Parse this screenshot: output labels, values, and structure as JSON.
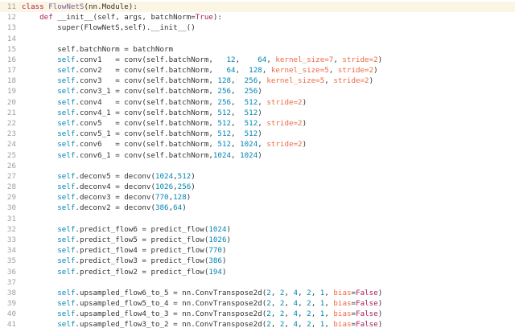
{
  "editor": {
    "lines": [
      {
        "n": "11",
        "hl": true,
        "tokens": [
          [
            "keyword",
            "class "
          ],
          [
            "classname",
            "FlowNetS"
          ],
          [
            "plain",
            "(nn.Module):"
          ]
        ]
      },
      {
        "n": "12",
        "tokens": [
          [
            "plain",
            "    "
          ],
          [
            "keyword",
            "def "
          ],
          [
            "plain",
            "__init__(self, args, batchNorm="
          ],
          [
            "keyword",
            "True"
          ],
          [
            "plain",
            "):"
          ]
        ]
      },
      {
        "n": "13",
        "tokens": [
          [
            "plain",
            "        super(FlowNetS,self).__init__()"
          ]
        ]
      },
      {
        "n": "14",
        "tokens": []
      },
      {
        "n": "15",
        "tokens": [
          [
            "plain",
            "        self.batchNorm = batchNorm"
          ]
        ]
      },
      {
        "n": "16",
        "tokens": [
          [
            "plain",
            "        "
          ],
          [
            "self",
            "self"
          ],
          [
            "plain",
            ".conv1   = conv(self.batchNorm,   "
          ],
          [
            "number",
            "12"
          ],
          [
            "plain",
            ",    "
          ],
          [
            "number",
            "64"
          ],
          [
            "plain",
            ", "
          ],
          [
            "kwarg",
            "kernel_size=7"
          ],
          [
            "plain",
            ", "
          ],
          [
            "kwarg",
            "stride=2"
          ],
          [
            "plain",
            ")"
          ]
        ]
      },
      {
        "n": "17",
        "tokens": [
          [
            "plain",
            "        "
          ],
          [
            "self",
            "self"
          ],
          [
            "plain",
            ".conv2   = conv(self.batchNorm,   "
          ],
          [
            "number",
            "64"
          ],
          [
            "plain",
            ",  "
          ],
          [
            "number",
            "128"
          ],
          [
            "plain",
            ", "
          ],
          [
            "kwarg",
            "kernel_size=5"
          ],
          [
            "plain",
            ", "
          ],
          [
            "kwarg",
            "stride=2"
          ],
          [
            "plain",
            ")"
          ]
        ]
      },
      {
        "n": "18",
        "tokens": [
          [
            "plain",
            "        "
          ],
          [
            "self",
            "self"
          ],
          [
            "plain",
            ".conv3   = conv(self.batchNorm, "
          ],
          [
            "number",
            "128"
          ],
          [
            "plain",
            ",  "
          ],
          [
            "number",
            "256"
          ],
          [
            "plain",
            ", "
          ],
          [
            "kwarg",
            "kernel_size=5"
          ],
          [
            "plain",
            ", "
          ],
          [
            "kwarg",
            "stride=2"
          ],
          [
            "plain",
            ")"
          ]
        ]
      },
      {
        "n": "19",
        "tokens": [
          [
            "plain",
            "        "
          ],
          [
            "self",
            "self"
          ],
          [
            "plain",
            ".conv3_1 = conv(self.batchNorm, "
          ],
          [
            "number",
            "256"
          ],
          [
            "plain",
            ",  "
          ],
          [
            "number",
            "256"
          ],
          [
            "plain",
            ")"
          ]
        ]
      },
      {
        "n": "20",
        "tokens": [
          [
            "plain",
            "        "
          ],
          [
            "self",
            "self"
          ],
          [
            "plain",
            ".conv4   = conv(self.batchNorm, "
          ],
          [
            "number",
            "256"
          ],
          [
            "plain",
            ",  "
          ],
          [
            "number",
            "512"
          ],
          [
            "plain",
            ", "
          ],
          [
            "kwarg",
            "stride=2"
          ],
          [
            "plain",
            ")"
          ]
        ]
      },
      {
        "n": "21",
        "tokens": [
          [
            "plain",
            "        "
          ],
          [
            "self",
            "self"
          ],
          [
            "plain",
            ".conv4_1 = conv(self.batchNorm, "
          ],
          [
            "number",
            "512"
          ],
          [
            "plain",
            ",  "
          ],
          [
            "number",
            "512"
          ],
          [
            "plain",
            ")"
          ]
        ]
      },
      {
        "n": "22",
        "tokens": [
          [
            "plain",
            "        "
          ],
          [
            "self",
            "self"
          ],
          [
            "plain",
            ".conv5   = conv(self.batchNorm, "
          ],
          [
            "number",
            "512"
          ],
          [
            "plain",
            ",  "
          ],
          [
            "number",
            "512"
          ],
          [
            "plain",
            ", "
          ],
          [
            "kwarg",
            "stride=2"
          ],
          [
            "plain",
            ")"
          ]
        ]
      },
      {
        "n": "23",
        "tokens": [
          [
            "plain",
            "        "
          ],
          [
            "self",
            "self"
          ],
          [
            "plain",
            ".conv5_1 = conv(self.batchNorm, "
          ],
          [
            "number",
            "512"
          ],
          [
            "plain",
            ",  "
          ],
          [
            "number",
            "512"
          ],
          [
            "plain",
            ")"
          ]
        ]
      },
      {
        "n": "24",
        "tokens": [
          [
            "plain",
            "        "
          ],
          [
            "self",
            "self"
          ],
          [
            "plain",
            ".conv6   = conv(self.batchNorm, "
          ],
          [
            "number",
            "512"
          ],
          [
            "plain",
            ", "
          ],
          [
            "number",
            "1024"
          ],
          [
            "plain",
            ", "
          ],
          [
            "kwarg",
            "stride=2"
          ],
          [
            "plain",
            ")"
          ]
        ]
      },
      {
        "n": "25",
        "tokens": [
          [
            "plain",
            "        "
          ],
          [
            "self",
            "self"
          ],
          [
            "plain",
            ".conv6_1 = conv(self.batchNorm,"
          ],
          [
            "number",
            "1024"
          ],
          [
            "plain",
            ", "
          ],
          [
            "number",
            "1024"
          ],
          [
            "plain",
            ")"
          ]
        ]
      },
      {
        "n": "26",
        "tokens": []
      },
      {
        "n": "27",
        "tokens": [
          [
            "plain",
            "        "
          ],
          [
            "self",
            "self"
          ],
          [
            "plain",
            ".deconv5 = deconv("
          ],
          [
            "number",
            "1024"
          ],
          [
            "plain",
            ","
          ],
          [
            "number",
            "512"
          ],
          [
            "plain",
            ")"
          ]
        ]
      },
      {
        "n": "28",
        "tokens": [
          [
            "plain",
            "        "
          ],
          [
            "self",
            "self"
          ],
          [
            "plain",
            ".deconv4 = deconv("
          ],
          [
            "number",
            "1026"
          ],
          [
            "plain",
            ","
          ],
          [
            "number",
            "256"
          ],
          [
            "plain",
            ")"
          ]
        ]
      },
      {
        "n": "29",
        "tokens": [
          [
            "plain",
            "        "
          ],
          [
            "self",
            "self"
          ],
          [
            "plain",
            ".deconv3 = deconv("
          ],
          [
            "number",
            "770"
          ],
          [
            "plain",
            ","
          ],
          [
            "number",
            "128"
          ],
          [
            "plain",
            ")"
          ]
        ]
      },
      {
        "n": "30",
        "tokens": [
          [
            "plain",
            "        "
          ],
          [
            "self",
            "self"
          ],
          [
            "plain",
            ".deconv2 = deconv("
          ],
          [
            "number",
            "386"
          ],
          [
            "plain",
            ","
          ],
          [
            "number",
            "64"
          ],
          [
            "plain",
            ")"
          ]
        ]
      },
      {
        "n": "31",
        "tokens": []
      },
      {
        "n": "32",
        "tokens": [
          [
            "plain",
            "        "
          ],
          [
            "self",
            "self"
          ],
          [
            "plain",
            ".predict_flow6 = predict_flow("
          ],
          [
            "number",
            "1024"
          ],
          [
            "plain",
            ")"
          ]
        ]
      },
      {
        "n": "33",
        "tokens": [
          [
            "plain",
            "        "
          ],
          [
            "self",
            "self"
          ],
          [
            "plain",
            ".predict_flow5 = predict_flow("
          ],
          [
            "number",
            "1026"
          ],
          [
            "plain",
            ")"
          ]
        ]
      },
      {
        "n": "34",
        "tokens": [
          [
            "plain",
            "        "
          ],
          [
            "self",
            "self"
          ],
          [
            "plain",
            ".predict_flow4 = predict_flow("
          ],
          [
            "number",
            "770"
          ],
          [
            "plain",
            ")"
          ]
        ]
      },
      {
        "n": "35",
        "tokens": [
          [
            "plain",
            "        "
          ],
          [
            "self",
            "self"
          ],
          [
            "plain",
            ".predict_flow3 = predict_flow("
          ],
          [
            "number",
            "386"
          ],
          [
            "plain",
            ")"
          ]
        ]
      },
      {
        "n": "36",
        "tokens": [
          [
            "plain",
            "        "
          ],
          [
            "self",
            "self"
          ],
          [
            "plain",
            ".predict_flow2 = predict_flow("
          ],
          [
            "number",
            "194"
          ],
          [
            "plain",
            ")"
          ]
        ]
      },
      {
        "n": "37",
        "tokens": []
      },
      {
        "n": "38",
        "tokens": [
          [
            "plain",
            "        "
          ],
          [
            "self",
            "self"
          ],
          [
            "plain",
            ".upsampled_flow6_to_5 = nn.ConvTranspose2d("
          ],
          [
            "number",
            "2"
          ],
          [
            "plain",
            ", "
          ],
          [
            "number",
            "2"
          ],
          [
            "plain",
            ", "
          ],
          [
            "number",
            "4"
          ],
          [
            "plain",
            ", "
          ],
          [
            "number",
            "2"
          ],
          [
            "plain",
            ", "
          ],
          [
            "number",
            "1"
          ],
          [
            "plain",
            ", "
          ],
          [
            "kwarg",
            "bias"
          ],
          [
            "plain",
            "="
          ],
          [
            "keyword",
            "False"
          ],
          [
            "plain",
            ")"
          ]
        ]
      },
      {
        "n": "39",
        "tokens": [
          [
            "plain",
            "        "
          ],
          [
            "self",
            "self"
          ],
          [
            "plain",
            ".upsampled_flow5_to_4 = nn.ConvTranspose2d("
          ],
          [
            "number",
            "2"
          ],
          [
            "plain",
            ", "
          ],
          [
            "number",
            "2"
          ],
          [
            "plain",
            ", "
          ],
          [
            "number",
            "4"
          ],
          [
            "plain",
            ", "
          ],
          [
            "number",
            "2"
          ],
          [
            "plain",
            ", "
          ],
          [
            "number",
            "1"
          ],
          [
            "plain",
            ", "
          ],
          [
            "kwarg",
            "bias"
          ],
          [
            "plain",
            "="
          ],
          [
            "keyword",
            "False"
          ],
          [
            "plain",
            ")"
          ]
        ]
      },
      {
        "n": "40",
        "tokens": [
          [
            "plain",
            "        "
          ],
          [
            "self",
            "self"
          ],
          [
            "plain",
            ".upsampled_flow4_to_3 = nn.ConvTranspose2d("
          ],
          [
            "number",
            "2"
          ],
          [
            "plain",
            ", "
          ],
          [
            "number",
            "2"
          ],
          [
            "plain",
            ", "
          ],
          [
            "number",
            "4"
          ],
          [
            "plain",
            ", "
          ],
          [
            "number",
            "2"
          ],
          [
            "plain",
            ", "
          ],
          [
            "number",
            "1"
          ],
          [
            "plain",
            ", "
          ],
          [
            "kwarg",
            "bias"
          ],
          [
            "plain",
            "="
          ],
          [
            "keyword",
            "False"
          ],
          [
            "plain",
            ")"
          ]
        ]
      },
      {
        "n": "41",
        "tokens": [
          [
            "plain",
            "        "
          ],
          [
            "self",
            "self"
          ],
          [
            "plain",
            ".upsampled_flow3_to_2 = nn.ConvTranspose2d("
          ],
          [
            "number",
            "2"
          ],
          [
            "plain",
            ", "
          ],
          [
            "number",
            "2"
          ],
          [
            "plain",
            ", "
          ],
          [
            "number",
            "4"
          ],
          [
            "plain",
            ", "
          ],
          [
            "number",
            "2"
          ],
          [
            "plain",
            ", "
          ],
          [
            "number",
            "1"
          ],
          [
            "plain",
            ", "
          ],
          [
            "kwarg",
            "bias"
          ],
          [
            "plain",
            "="
          ],
          [
            "keyword",
            "False"
          ],
          [
            "plain",
            ")"
          ]
        ]
      }
    ]
  }
}
